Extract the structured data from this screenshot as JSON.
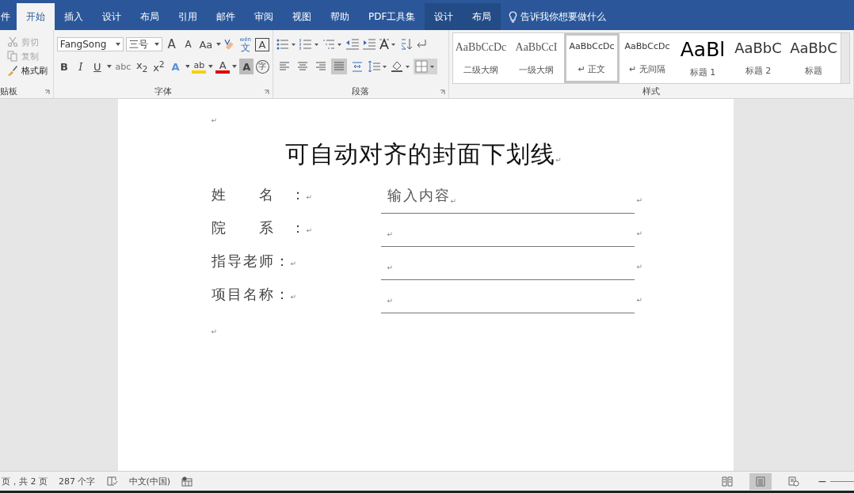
{
  "tabs": [
    {
      "label": "件",
      "selected": false,
      "kind": "normal"
    },
    {
      "label": "开始",
      "selected": true,
      "kind": "normal"
    },
    {
      "label": "插入",
      "selected": false,
      "kind": "normal"
    },
    {
      "label": "设计",
      "selected": false,
      "kind": "normal"
    },
    {
      "label": "布局",
      "selected": false,
      "kind": "normal"
    },
    {
      "label": "引用",
      "selected": false,
      "kind": "normal"
    },
    {
      "label": "邮件",
      "selected": false,
      "kind": "normal"
    },
    {
      "label": "审阅",
      "selected": false,
      "kind": "normal"
    },
    {
      "label": "视图",
      "selected": false,
      "kind": "normal"
    },
    {
      "label": "帮助",
      "selected": false,
      "kind": "normal"
    },
    {
      "label": "PDF工具集",
      "selected": false,
      "kind": "normal"
    },
    {
      "label": "设计",
      "selected": false,
      "kind": "context"
    },
    {
      "label": "布局",
      "selected": false,
      "kind": "context"
    }
  ],
  "tell_me": "告诉我你想要做什么",
  "clipboard": {
    "label": "贴板",
    "items": [
      {
        "label": "剪切",
        "disabled": true,
        "kind": "cut"
      },
      {
        "label": "复制",
        "disabled": true,
        "kind": "copy"
      },
      {
        "label": "格式刷",
        "disabled": false,
        "kind": "brush"
      }
    ]
  },
  "font": {
    "label": "字体",
    "font_name": "FangSong",
    "font_size": "三号",
    "row1": [
      {
        "text": "A",
        "kind": "grow"
      },
      {
        "text": "A",
        "kind": "shrink"
      },
      {
        "text": "Aa",
        "kind": "case"
      },
      {
        "text": "文",
        "ruby": "wén",
        "kind": "phonetic"
      },
      {
        "text": "A",
        "kind": "border"
      }
    ],
    "row2": [
      {
        "text": "B",
        "kind": "bold"
      },
      {
        "text": "I",
        "kind": "italic"
      },
      {
        "text": "U",
        "kind": "underline"
      },
      {
        "text": "abc",
        "kind": "strike"
      },
      {
        "text": "x$_{2}$",
        "kind": "plain"
      },
      {
        "text": "x$^{2}$",
        "kind": "plain"
      },
      {
        "text": "A",
        "kind": "effects"
      },
      {
        "text": "ab",
        "kind": "highlight"
      },
      {
        "text": "A",
        "kind": "color"
      },
      {
        "text": "A",
        "kind": "shade"
      },
      {
        "text": "字",
        "kind": "enclose"
      }
    ]
  },
  "paragraph": {
    "label": "段落",
    "alignment": [
      {
        "selected": false
      },
      {
        "selected": false
      },
      {
        "selected": false
      },
      {
        "selected": true
      },
      {
        "selected": false
      }
    ]
  },
  "styles": {
    "label": "样式",
    "items": [
      {
        "preview": "AaBbCcDc",
        "name": "二级大纲",
        "kind": "outline",
        "selected": false
      },
      {
        "preview": "AaBbCcI",
        "name": "一级大纲",
        "kind": "outline",
        "selected": false
      },
      {
        "preview": "AaBbCcDc",
        "name": "↵ 正文",
        "kind": "body",
        "selected": true
      },
      {
        "preview": "AaBbCcDc",
        "name": "↵ 无间隔",
        "kind": "body",
        "selected": false
      },
      {
        "preview": "AaBl",
        "name": "标题 1",
        "kind": "h1",
        "selected": false
      },
      {
        "preview": "AaBbC",
        "name": "标题 2",
        "kind": "h2",
        "selected": false
      },
      {
        "preview": "AaBbC",
        "name": "标题",
        "kind": "h2",
        "selected": false
      }
    ]
  },
  "document": {
    "top_mark": "↵",
    "title": "可自动对齐的封面下划线",
    "title_mark": "↵",
    "rows": [
      {
        "label": "姓　　名　：",
        "label_mark": "↵",
        "value": "输入内容",
        "value_mark": "↵",
        "end_mark": "↵"
      },
      {
        "label": "院　　系　：",
        "label_mark": "↵",
        "value_mark": "↵",
        "end_mark": "↵"
      },
      {
        "label": "指导老师：",
        "label_mark": "↵",
        "value_mark": "↵",
        "end_mark": "↵"
      },
      {
        "label": "项目名称：",
        "label_mark": "↵",
        "value_mark": "↵",
        "end_mark": "↵"
      }
    ],
    "bottom_mark": "↵"
  },
  "status_bar": {
    "page": "页，共 2 页",
    "words": "287 个字",
    "language": "中文(中国)",
    "views": [
      {
        "kind": "read",
        "selected": false
      },
      {
        "kind": "print",
        "selected": true
      },
      {
        "kind": "web",
        "selected": false
      }
    ],
    "zoom_out": "−"
  }
}
